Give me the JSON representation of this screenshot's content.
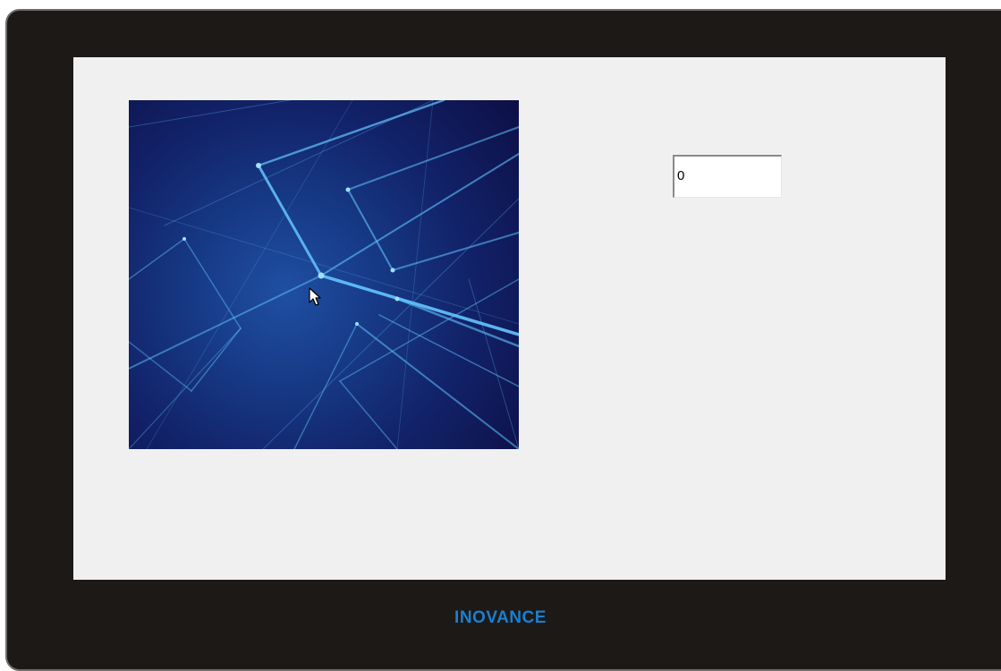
{
  "device": {
    "brand": "INOVANCE",
    "accent_color": "#1b7fd0"
  },
  "screen": {
    "background": "#f0f0f0",
    "image_widget": {
      "description": "abstract-blue-wireframe-graphic"
    },
    "numeric_input": {
      "value": "0"
    }
  },
  "cursor": {
    "icon": "arrow-pointer-icon"
  }
}
